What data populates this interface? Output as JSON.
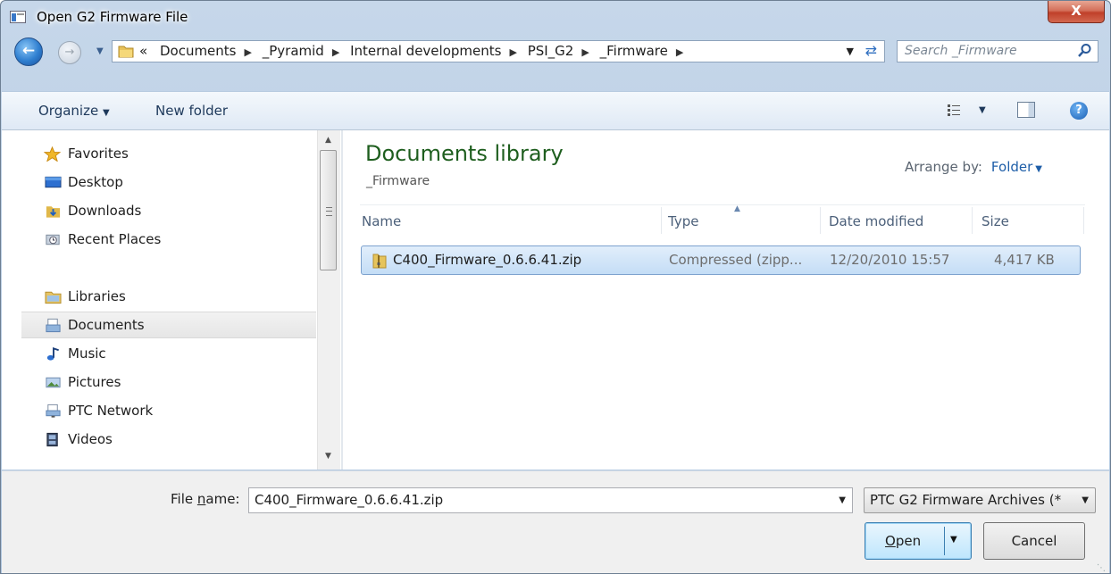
{
  "window": {
    "title": "Open G2 Firmware File",
    "close_label": "X"
  },
  "address": {
    "overflow": "«",
    "crumbs": [
      "Documents",
      "_Pyramid",
      "Internal developments",
      "PSI_G2",
      "_Firmware"
    ]
  },
  "search": {
    "placeholder": "Search _Firmware"
  },
  "toolbar": {
    "organize": "Organize",
    "new_folder": "New folder",
    "help": "?"
  },
  "nav": {
    "items": [
      {
        "label": "Favorites",
        "icon": "star-icon"
      },
      {
        "label": "Desktop",
        "icon": "desktop-icon"
      },
      {
        "label": "Downloads",
        "icon": "downloads-icon"
      },
      {
        "label": "Recent Places",
        "icon": "recent-places-icon"
      },
      {
        "label": "Libraries",
        "icon": "libraries-icon"
      },
      {
        "label": "Documents",
        "icon": "documents-icon",
        "selected": true
      },
      {
        "label": "Music",
        "icon": "music-icon"
      },
      {
        "label": "Pictures",
        "icon": "pictures-icon"
      },
      {
        "label": "PTC Network",
        "icon": "network-icon"
      },
      {
        "label": "Videos",
        "icon": "videos-icon"
      }
    ]
  },
  "main": {
    "library_title": "Documents library",
    "library_subtitle": "_Firmware",
    "arrange_label": "Arrange by:",
    "arrange_value": "Folder",
    "columns": [
      "Name",
      "Type",
      "Date modified",
      "Size"
    ],
    "files": [
      {
        "name": "C400_Firmware_0.6.6.41.zip",
        "type": "Compressed (zipp...",
        "date": "12/20/2010 15:57",
        "size": "4,417 KB"
      }
    ]
  },
  "bottom": {
    "filename_label_pre": "File ",
    "filename_label_u": "n",
    "filename_label_post": "ame:",
    "filename_value": "C400_Firmware_0.6.6.41.zip",
    "filter_value": "PTC G2 Firmware Archives (*",
    "open_u": "O",
    "open_rest": "pen",
    "cancel": "Cancel"
  },
  "colors": {
    "title_green": "#1e5e1e",
    "link_blue": "#1e5ea8",
    "selection": "#c4ddf6"
  }
}
